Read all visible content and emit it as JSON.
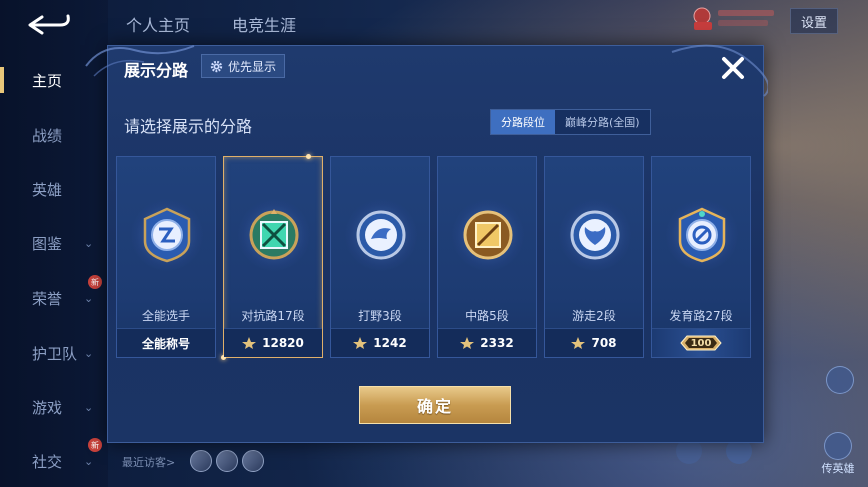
{
  "background": {
    "top_tabs": [
      "个人主页",
      "电竞生涯"
    ],
    "settings_label": "设置",
    "nav": [
      {
        "label": "主页",
        "active": true,
        "chevron": false,
        "badge": false
      },
      {
        "label": "战绩",
        "active": false,
        "chevron": false,
        "badge": false
      },
      {
        "label": "英雄",
        "active": false,
        "chevron": false,
        "badge": false
      },
      {
        "label": "图鉴",
        "active": false,
        "chevron": true,
        "badge": false
      },
      {
        "label": "荣誉",
        "active": false,
        "chevron": true,
        "badge": true
      },
      {
        "label": "护卫队",
        "active": false,
        "chevron": true,
        "badge": false
      },
      {
        "label": "游戏",
        "active": false,
        "chevron": true,
        "badge": false
      },
      {
        "label": "社交",
        "active": false,
        "chevron": true,
        "badge": true
      }
    ],
    "badge_text": "新",
    "chevron_glyph": "⌄",
    "recent_visitors_label": "最近访客>",
    "right_buttons": [
      "",
      "传英雄"
    ]
  },
  "modal": {
    "title": "展示分路",
    "priority_label": "优先显示",
    "prompt": "请选择展示的分路",
    "segments": [
      {
        "label": "分路段位",
        "active": true
      },
      {
        "label": "巅峰分路(全国)",
        "active": false
      }
    ],
    "cards": [
      {
        "name": "全能选手",
        "footer_text": "全能称号",
        "footer_type": "title",
        "emblem": "allround-emblem-icon",
        "selected": false
      },
      {
        "name": "对抗路17段",
        "footer_text": "12820",
        "footer_type": "score",
        "emblem": "clash-lane-emblem-icon",
        "selected": true
      },
      {
        "name": "打野3段",
        "footer_text": "1242",
        "footer_type": "score",
        "emblem": "jungle-emblem-icon",
        "selected": false
      },
      {
        "name": "中路5段",
        "footer_text": "2332",
        "footer_type": "score",
        "emblem": "mid-lane-emblem-icon",
        "selected": false
      },
      {
        "name": "游走2段",
        "footer_text": "708",
        "footer_type": "score",
        "emblem": "roam-emblem-icon",
        "selected": false
      },
      {
        "name": "发育路27段",
        "footer_text": "100",
        "footer_type": "ribbon",
        "emblem": "farm-lane-emblem-icon",
        "selected": false
      }
    ],
    "confirm_label": "确定"
  },
  "colors": {
    "accent_gold": "#e0b06a",
    "segment_active": "#3e6fc0",
    "modal_bg": "#1f3a6e"
  }
}
